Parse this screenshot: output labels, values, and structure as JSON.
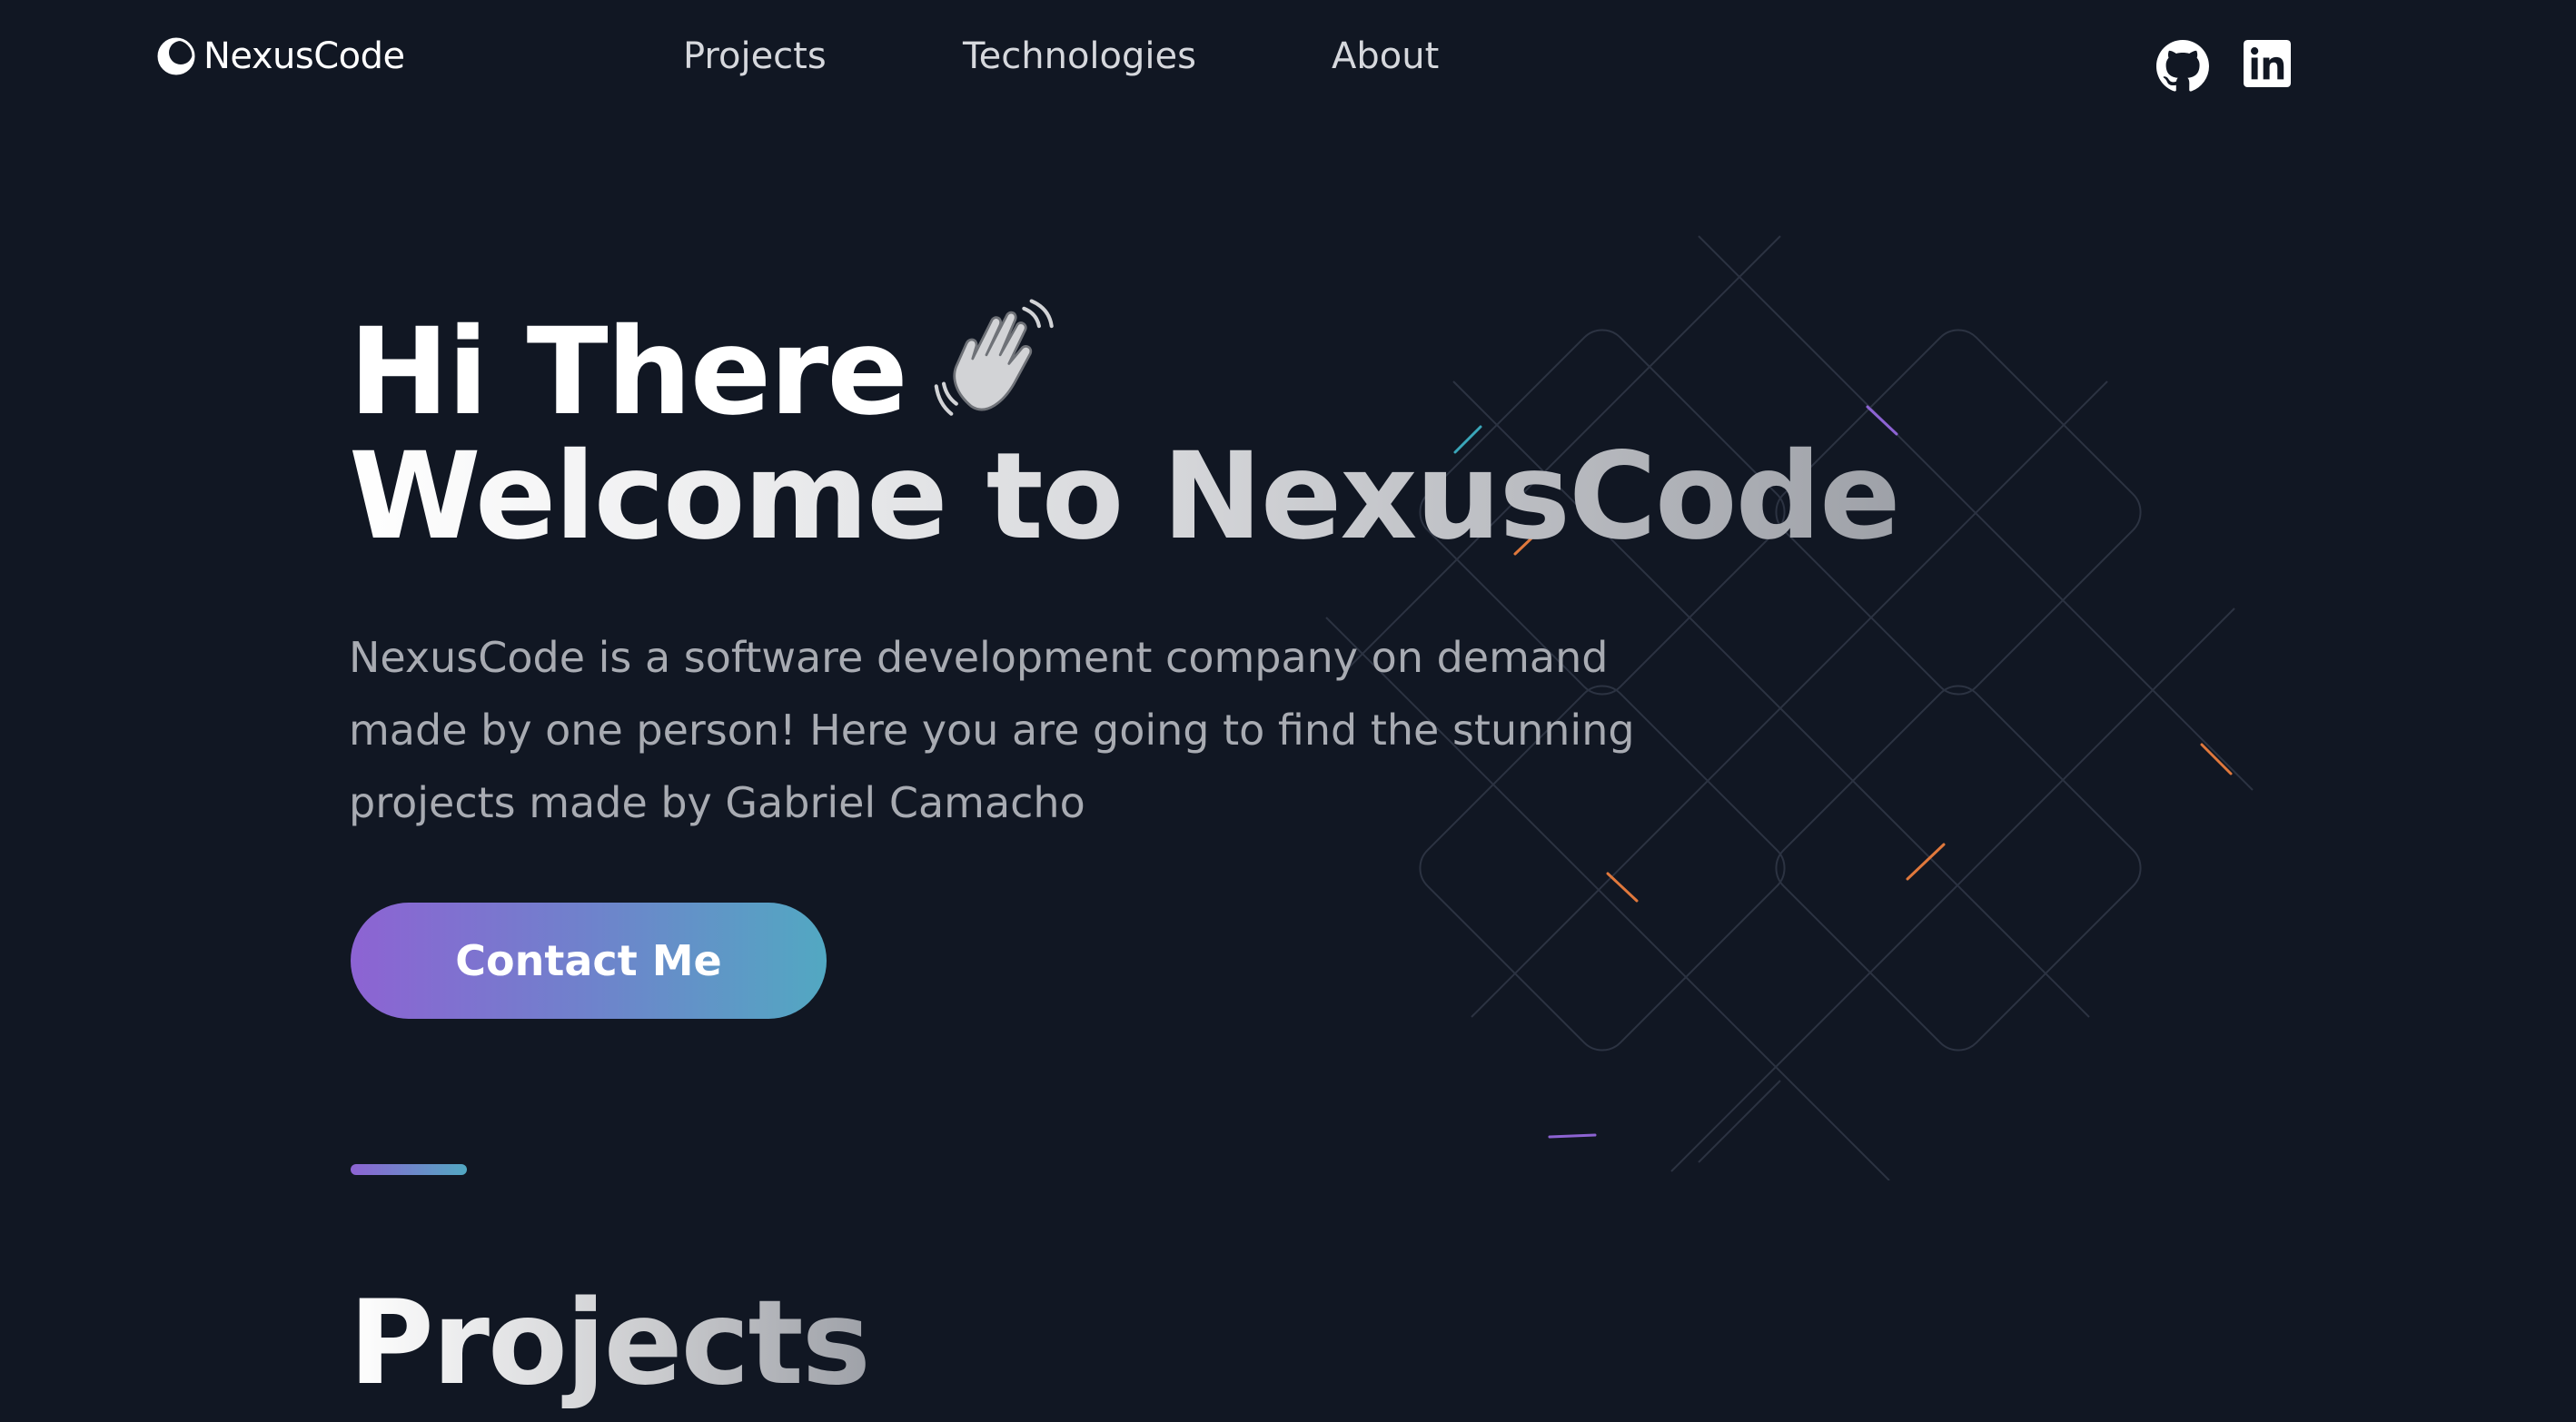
{
  "nav": {
    "logo_text": "NexusCode",
    "links": [
      {
        "label": "Projects"
      },
      {
        "label": "Technologies"
      },
      {
        "label": "About"
      }
    ],
    "social": [
      {
        "icon": "github-icon"
      },
      {
        "icon": "linkedin-icon"
      }
    ]
  },
  "hero": {
    "line1": "Hi There",
    "line1_icon": "waving-hand-icon",
    "line2": "Welcome to NexusCode",
    "description": "NexusCode is a software development company on demand made by one person! Here you are going to find the stunning projects made by Gabriel Camacho",
    "cta_label": "Contact Me"
  },
  "sections": {
    "projects_title": "Projects"
  },
  "colors": {
    "background": "#111723",
    "accent_start": "#8d63d3",
    "accent_end": "#52a8c2",
    "text_muted": "#a8abb2",
    "nav_text": "#d6d8dd"
  }
}
